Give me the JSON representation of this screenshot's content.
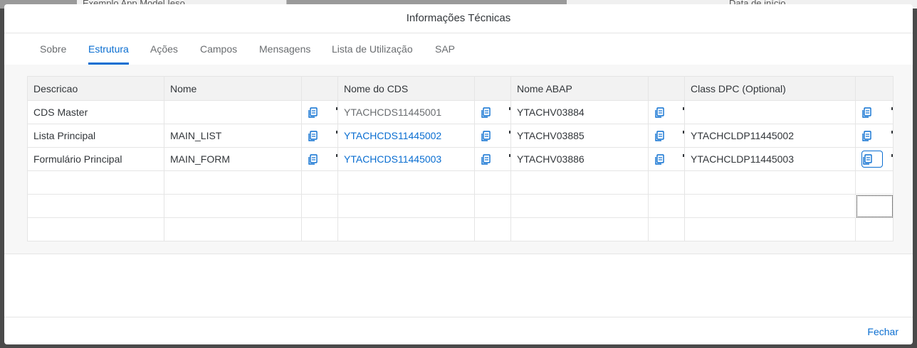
{
  "backdrop": {
    "cells": [
      "Exemplo App Model Ieso",
      "Data de início"
    ]
  },
  "dialog": {
    "title": "Informações Técnicas",
    "close_label": "Fechar"
  },
  "tabs": [
    {
      "label": "Sobre",
      "active": false
    },
    {
      "label": "Estrutura",
      "active": true
    },
    {
      "label": "Ações",
      "active": false
    },
    {
      "label": "Campos",
      "active": false
    },
    {
      "label": "Mensagens",
      "active": false
    },
    {
      "label": "Lista de Utilização",
      "active": false
    },
    {
      "label": "SAP",
      "active": false
    }
  ],
  "table": {
    "headers": [
      "Descricao",
      "Nome",
      "",
      "Nome do CDS",
      "",
      "Nome ABAP",
      "",
      "Class DPC (Optional)",
      ""
    ],
    "rows": [
      {
        "descricao": "CDS Master",
        "nome": "",
        "cds": "YTACHCDS11445001",
        "cds_link": false,
        "abap": "YTACHV03884",
        "dpc": ""
      },
      {
        "descricao": "Lista Principal",
        "nome": "MAIN_LIST",
        "cds": "YTACHCDS11445002",
        "cds_link": true,
        "abap": "YTACHV03885",
        "dpc": "YTACHCLDP11445002"
      },
      {
        "descricao": "Formulário Principal",
        "nome": "MAIN_FORM",
        "cds": "YTACHCDS11445003",
        "cds_link": true,
        "abap": "YTACHV03886",
        "dpc": "YTACHCLDP11445003"
      }
    ],
    "empty_rows": 3
  },
  "icons": {
    "copy": "copy-icon"
  },
  "colors": {
    "accent": "#0a6ed1",
    "text": "#32363a",
    "muted": "#6a6d70"
  }
}
